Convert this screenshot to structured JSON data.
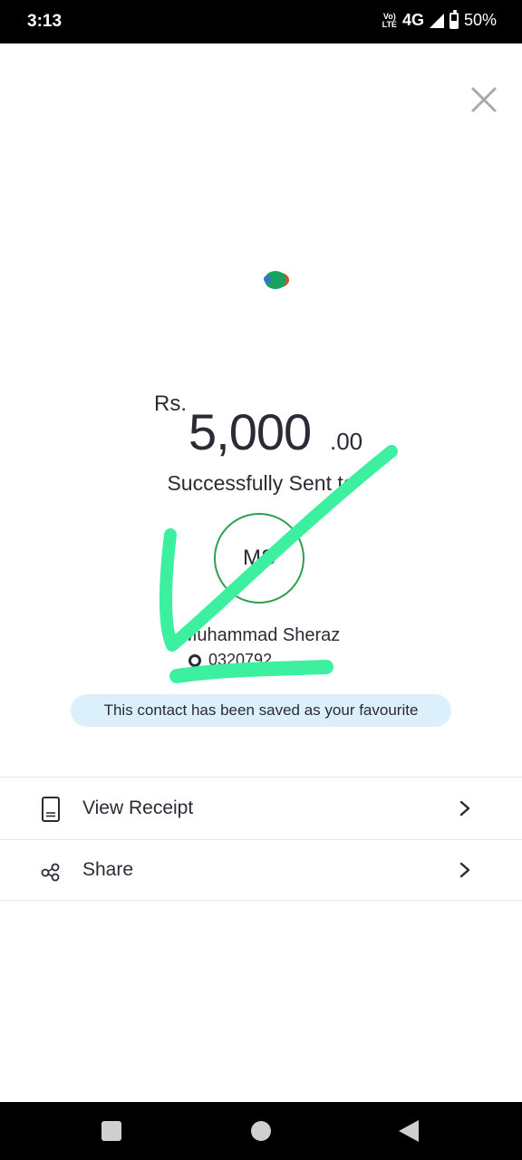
{
  "status_bar": {
    "time": "3:13",
    "volte_top": "Vo)",
    "volte_bottom": "LTE",
    "network": "4G",
    "battery": "50%",
    "battery_level": 0.5
  },
  "transaction": {
    "currency": "Rs.",
    "amount": "5,000",
    "decimals": ".00",
    "status_text": "Successfully Sent to"
  },
  "recipient": {
    "initials": "MS",
    "name": "Muhammad Sheraz",
    "number": "0320792"
  },
  "favourite_note": "This contact has been saved as your favourite",
  "actions": [
    {
      "label": "View Receipt",
      "icon": "receipt-icon"
    },
    {
      "label": "Share",
      "icon": "share-icon"
    }
  ],
  "colors": {
    "accent_green": "#2e9e4f",
    "highlight_mark": "#3df0a0",
    "note_background": "#dcf0fb",
    "text": "#2b2b36"
  },
  "icons": {
    "close": "close-icon",
    "chevron": "chevron-right-icon",
    "phone": "phone-icon"
  }
}
